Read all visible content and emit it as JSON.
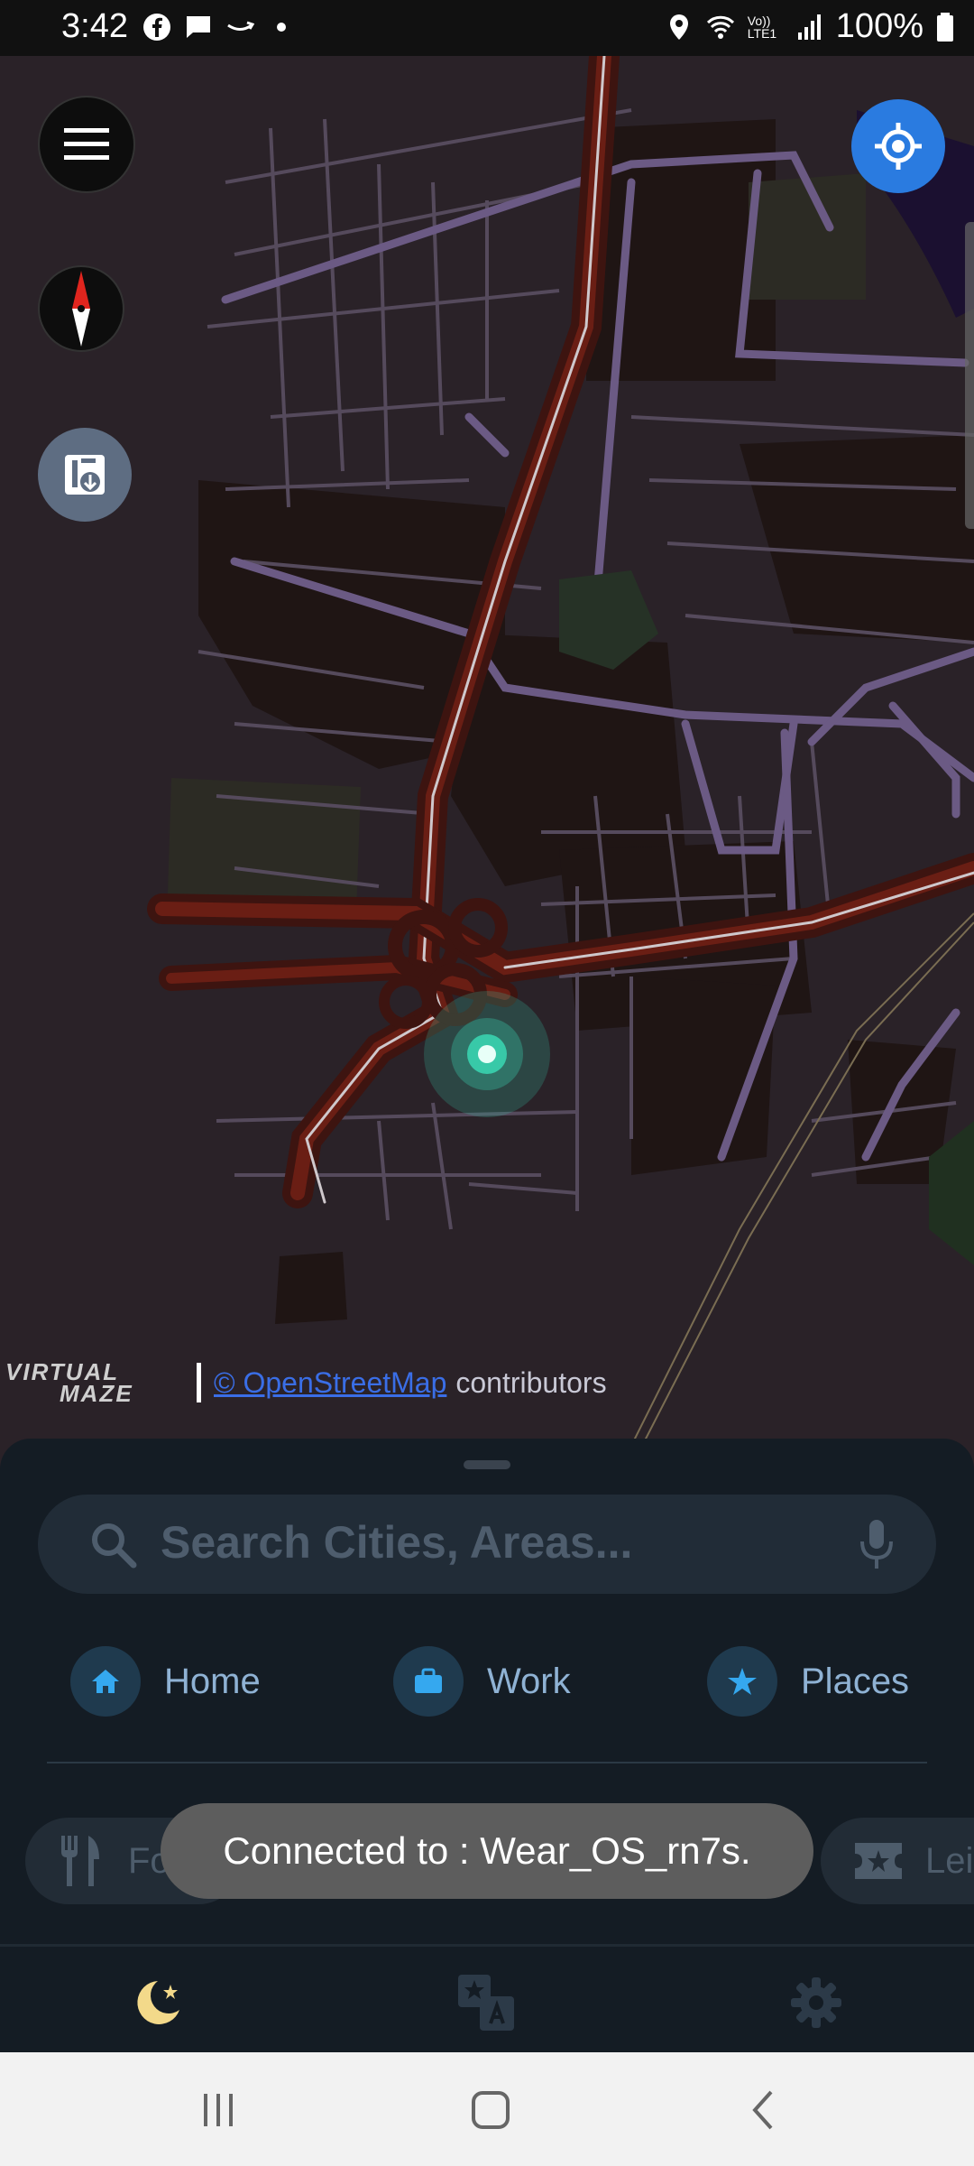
{
  "status_bar": {
    "time": "3:42",
    "battery": "100%",
    "network_label": "Vo)) LTE1",
    "icons": [
      "facebook-icon",
      "message-icon",
      "amazon-icon",
      "dot-icon",
      "location-icon",
      "wifi-icon",
      "signal-icon",
      "battery-icon"
    ]
  },
  "map": {
    "attribution": {
      "brand_line1": "VIRTUAL",
      "brand_line2": "MAZE",
      "link_text": "© OpenStreetMap",
      "suffix_text": "contributors"
    }
  },
  "search": {
    "placeholder": "Search Cities, Areas..."
  },
  "quick_links": [
    {
      "label": "Home",
      "icon": "home-icon"
    },
    {
      "label": "Work",
      "icon": "briefcase-icon"
    },
    {
      "label": "Places",
      "icon": "star-icon"
    }
  ],
  "categories": {
    "left_partial": "Fo",
    "right_partial": "Leis"
  },
  "toast": {
    "text": "Connected to : Wear_OS_rn7s."
  },
  "bottom_tabs": [
    "night-mode-icon",
    "translate-icon",
    "settings-icon"
  ],
  "colors": {
    "accent_blue": "#2a7be0",
    "location_dot": "#38c9a8",
    "night_icon": "#f3d98a",
    "road_major": "#6a1e14",
    "road_minor": "#5a4a6a"
  }
}
